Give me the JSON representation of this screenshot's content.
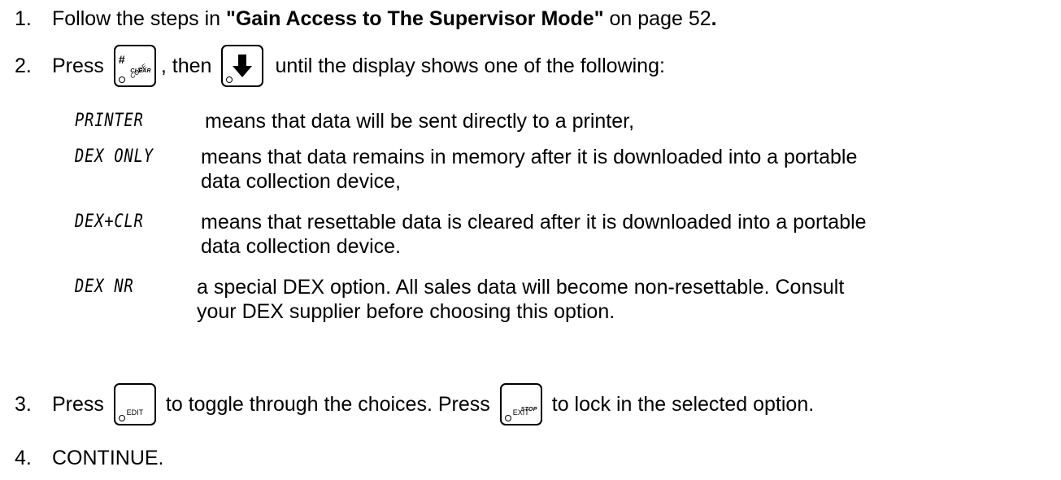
{
  "steps": [
    {
      "number": "1.",
      "prefix": "Follow the steps in ",
      "link_text": "\"Gain Access to The Supervisor Mode\"",
      "suffix": " on page 52",
      "suffix_end": "."
    },
    {
      "number": "2.",
      "prefix": "Press",
      "middle": ", then",
      "suffix": "until the display shows one of the following:"
    },
    {
      "number": "3.",
      "prefix": "Press",
      "middle": "to toggle through the choices. Press",
      "suffix": "to lock in the selected option."
    },
    {
      "number": "4.",
      "text": "CONTINUE."
    }
  ],
  "keys": {
    "code_clear": {
      "top": "#",
      "diagonal": "CODE",
      "sub": "CLEAR"
    },
    "down_arrow": {
      "icon": "down-arrow-icon"
    },
    "edit": {
      "label": "EDIT"
    },
    "exit_stop": {
      "label": "EXIT",
      "sub": "STOP"
    }
  },
  "options": [
    {
      "code": "PRINTER",
      "lines": [
        "means that data will be sent directly to a printer,"
      ]
    },
    {
      "code": "DEX ONLY",
      "lines": [
        "means that data remains in memory after it is downloaded into a portable",
        "data collection device,"
      ]
    },
    {
      "code": "DEX+CLR",
      "lines": [
        "means that resettable data is cleared after it is downloaded into a portable",
        "data collection device."
      ]
    },
    {
      "code": "DEX NR",
      "lines": [
        "a special DEX option. All sales data will become non-resettable. Consult",
        "your DEX supplier before choosing this option."
      ]
    }
  ]
}
